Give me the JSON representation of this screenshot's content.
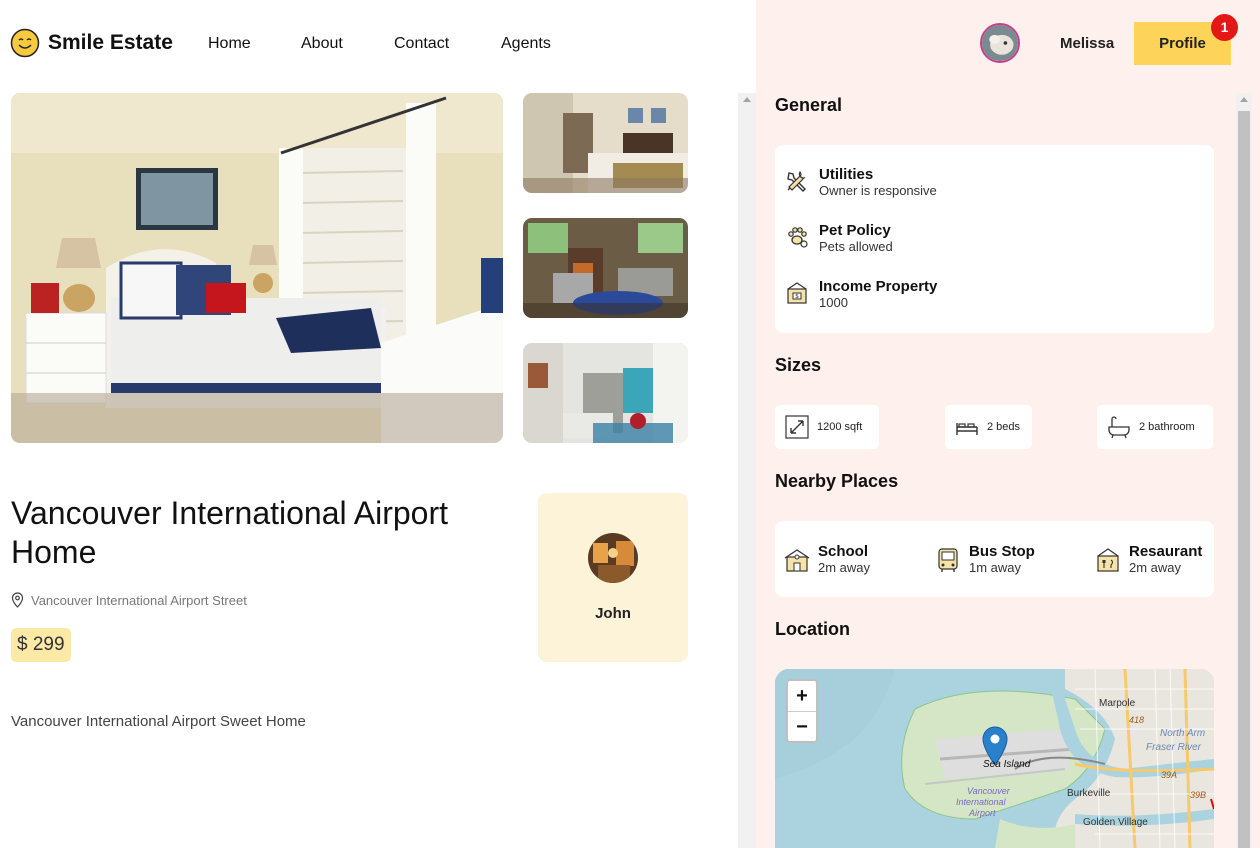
{
  "brand": {
    "name": "Smile Estate"
  },
  "nav": {
    "items": [
      "Home",
      "About",
      "Contact",
      "Agents"
    ]
  },
  "user": {
    "name": "Melissa",
    "profile_label": "Profile",
    "notification_count": "1"
  },
  "listing": {
    "title": "Vancouver International Airport Home",
    "address": "Vancouver International Airport Street",
    "price": "$ 299",
    "description": "Vancouver International Airport Sweet Home",
    "agent": {
      "name": "John"
    }
  },
  "details": {
    "general_heading": "General",
    "general": [
      {
        "title": "Utilities",
        "value": "Owner is responsive",
        "icon": "tools-icon"
      },
      {
        "title": "Pet Policy",
        "value": "Pets allowed",
        "icon": "paw-icon"
      },
      {
        "title": "Income Property",
        "value": "1000",
        "icon": "income-property-icon"
      }
    ],
    "sizes_heading": "Sizes",
    "sizes": [
      {
        "value": "1200 sqft",
        "icon": "expand-icon"
      },
      {
        "value": "2 beds",
        "icon": "bed-icon"
      },
      {
        "value": "2 bathroom",
        "icon": "bathtub-icon"
      }
    ],
    "nearby_heading": "Nearby Places",
    "nearby": [
      {
        "title": "School",
        "distance": "2m away",
        "icon": "school-icon"
      },
      {
        "title": "Bus Stop",
        "distance": "1m away",
        "icon": "bus-icon"
      },
      {
        "title": "Resaurant",
        "distance": "2m away",
        "icon": "restaurant-icon"
      }
    ],
    "location_heading": "Location"
  },
  "map": {
    "zoom_in": "+",
    "zoom_out": "−",
    "labels": {
      "marpole": "Marpole",
      "north_arm": "North Arm",
      "fraser_river": "Fraser River",
      "sea_island": "Sea Island",
      "airport_1": "Vancouver",
      "airport_2": "International",
      "airport_3": "Airport",
      "burkeville": "Burkeville",
      "golden_village": "Golden Village",
      "r418": "418",
      "r39a": "39A",
      "r39b": "39B"
    }
  },
  "colors": {
    "accent": "#fed35a",
    "badge": "#e41616",
    "right_bg": "#fdf0ed",
    "agent_card": "#fdf3d8",
    "price_bg": "#fde9a6"
  }
}
